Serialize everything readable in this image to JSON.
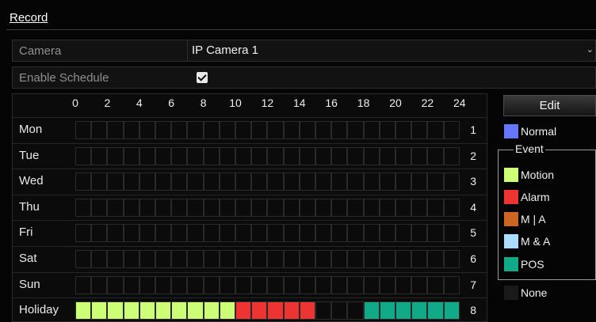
{
  "window": {
    "title": "Record"
  },
  "form": {
    "camera_label": "Camera",
    "camera_value": "IP Camera 1",
    "schedule_label": "Enable Schedule",
    "schedule_enabled": true
  },
  "schedule": {
    "hours": [
      "0",
      "2",
      "4",
      "6",
      "8",
      "10",
      "12",
      "14",
      "16",
      "18",
      "20",
      "22",
      "24"
    ],
    "days": [
      {
        "label": "Mon",
        "num": "1",
        "cells": [
          "none",
          "none",
          "none",
          "none",
          "none",
          "none",
          "none",
          "none",
          "none",
          "none",
          "none",
          "none",
          "none",
          "none",
          "none",
          "none",
          "none",
          "none",
          "none",
          "none",
          "none",
          "none",
          "none",
          "none"
        ]
      },
      {
        "label": "Tue",
        "num": "2",
        "cells": [
          "none",
          "none",
          "none",
          "none",
          "none",
          "none",
          "none",
          "none",
          "none",
          "none",
          "none",
          "none",
          "none",
          "none",
          "none",
          "none",
          "none",
          "none",
          "none",
          "none",
          "none",
          "none",
          "none",
          "none"
        ]
      },
      {
        "label": "Wed",
        "num": "3",
        "cells": [
          "none",
          "none",
          "none",
          "none",
          "none",
          "none",
          "none",
          "none",
          "none",
          "none",
          "none",
          "none",
          "none",
          "none",
          "none",
          "none",
          "none",
          "none",
          "none",
          "none",
          "none",
          "none",
          "none",
          "none"
        ]
      },
      {
        "label": "Thu",
        "num": "4",
        "cells": [
          "none",
          "none",
          "none",
          "none",
          "none",
          "none",
          "none",
          "none",
          "none",
          "none",
          "none",
          "none",
          "none",
          "none",
          "none",
          "none",
          "none",
          "none",
          "none",
          "none",
          "none",
          "none",
          "none",
          "none"
        ]
      },
      {
        "label": "Fri",
        "num": "5",
        "cells": [
          "none",
          "none",
          "none",
          "none",
          "none",
          "none",
          "none",
          "none",
          "none",
          "none",
          "none",
          "none",
          "none",
          "none",
          "none",
          "none",
          "none",
          "none",
          "none",
          "none",
          "none",
          "none",
          "none",
          "none"
        ]
      },
      {
        "label": "Sat",
        "num": "6",
        "cells": [
          "none",
          "none",
          "none",
          "none",
          "none",
          "none",
          "none",
          "none",
          "none",
          "none",
          "none",
          "none",
          "none",
          "none",
          "none",
          "none",
          "none",
          "none",
          "none",
          "none",
          "none",
          "none",
          "none",
          "none"
        ]
      },
      {
        "label": "Sun",
        "num": "7",
        "cells": [
          "none",
          "none",
          "none",
          "none",
          "none",
          "none",
          "none",
          "none",
          "none",
          "none",
          "none",
          "none",
          "none",
          "none",
          "none",
          "none",
          "none",
          "none",
          "none",
          "none",
          "none",
          "none",
          "none",
          "none"
        ]
      },
      {
        "label": "Holiday",
        "num": "8",
        "cells": [
          "motion",
          "motion",
          "motion",
          "motion",
          "motion",
          "motion",
          "motion",
          "motion",
          "motion",
          "motion",
          "alarm",
          "alarm",
          "alarm",
          "alarm",
          "alarm",
          "none",
          "none",
          "none",
          "pos",
          "pos",
          "pos",
          "pos",
          "pos",
          "pos"
        ]
      }
    ]
  },
  "panel": {
    "edit_label": "Edit",
    "event_title": "Event",
    "legend": [
      {
        "key": "normal",
        "label": "Normal",
        "color": "#6677ff"
      },
      {
        "key": "motion",
        "label": "Motion",
        "color": "#ccff77"
      },
      {
        "key": "alarm",
        "label": "Alarm",
        "color": "#ee3333"
      },
      {
        "key": "ma_or",
        "label": "M | A",
        "color": "#cc6622"
      },
      {
        "key": "ma_and",
        "label": "M & A",
        "color": "#aaddff"
      },
      {
        "key": "pos",
        "label": "POS",
        "color": "#11aa88"
      },
      {
        "key": "none",
        "label": "None",
        "color": "#1a1a1a"
      }
    ]
  }
}
